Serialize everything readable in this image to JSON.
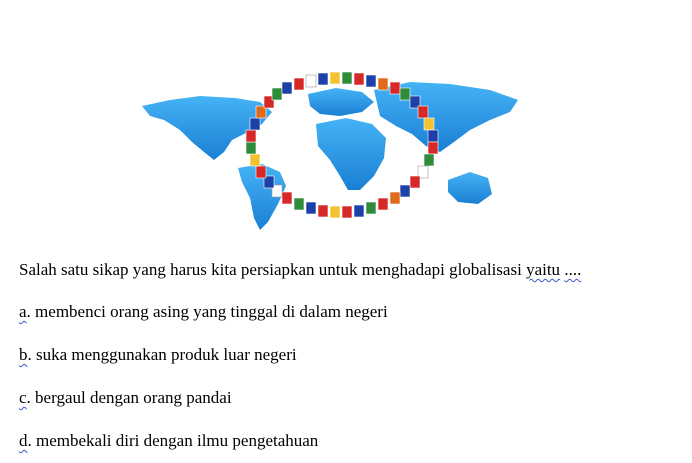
{
  "question": {
    "text": "Salah satu sikap yang harus kita persiapkan untuk menghadapi globalisasi",
    "keyword": "yaitu",
    "ellipsis": "...."
  },
  "options": [
    {
      "letter": "a",
      "text": ". membenci orang asing yang tinggal di dalam negeri"
    },
    {
      "letter": "b",
      "text": ". suka menggunakan produk luar negeri"
    },
    {
      "letter": "c",
      "text": ". bergaul dengan orang pandai"
    },
    {
      "letter": "d",
      "text": ". membekali diri dengan ilmu pengetahuan"
    }
  ],
  "colors": {
    "ocean_background": "#ffffff",
    "continent": "#1f8fe0",
    "continent_light": "#45b3f5",
    "spellcheck_underline": "#3b57c4"
  },
  "illustration": {
    "icon": "world-map-flags-icon"
  }
}
